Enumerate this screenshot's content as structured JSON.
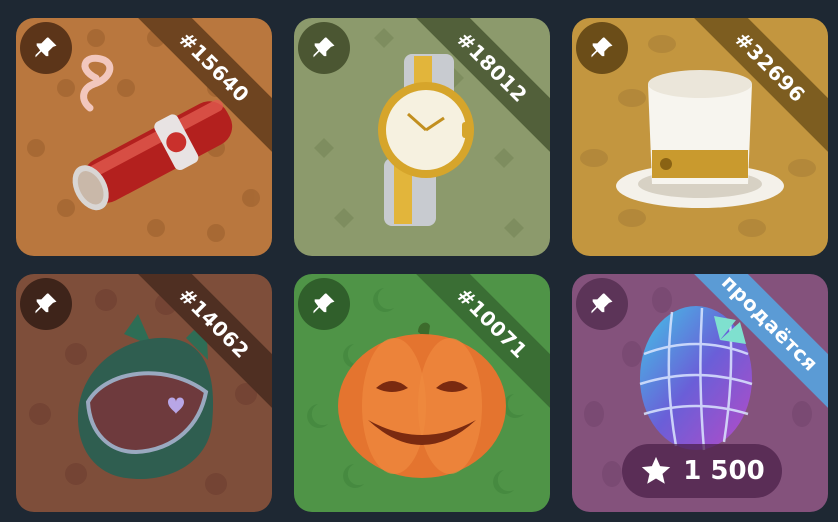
{
  "colors": {
    "page_bg": "#1e2833",
    "ribbon_sale": "#5b9bd5"
  },
  "cards": [
    {
      "id_label": "#15640",
      "item": "cigar",
      "pin_icon": "pin-icon",
      "bg": "#b9773e",
      "ribbon": "#6e4420",
      "pin_bg": "#5c3519",
      "pattern_color": "#a66834"
    },
    {
      "id_label": "#18012",
      "item": "gold-watch",
      "pin_icon": "pin-icon",
      "bg": "#8c9a6c",
      "ribbon": "#52603a",
      "pin_bg": "#4b5632",
      "pattern_color": "#7e8d5f"
    },
    {
      "id_label": "#32696",
      "item": "white-top-hat",
      "pin_icon": "pin-icon",
      "bg": "#c3963f",
      "ribbon": "#7d5d20",
      "pin_bg": "#6b4d18",
      "pattern_color": "#b3883a"
    },
    {
      "id_label": "#14062",
      "item": "cat-ear-helmet",
      "pin_icon": "pin-icon",
      "bg": "#7e4e3a",
      "ribbon": "#4f2f22",
      "pin_bg": "#3e241a",
      "pattern_color": "#744434"
    },
    {
      "id_label": "#10071",
      "item": "pumpkin",
      "pin_icon": "pin-icon",
      "bg": "#4f9447",
      "ribbon": "#3a6e34",
      "pin_bg": "#305f2b",
      "pattern_color": "#468a40"
    },
    {
      "id_label": "продаётся",
      "item": "easter-egg",
      "pin_icon": "pin-icon",
      "bg": "#84527c",
      "ribbon": "#5b9bd5",
      "pin_bg": "#5c3458",
      "pattern_color": "#7a4a73",
      "price": {
        "amount": "1 500",
        "currency_icon": "star-icon"
      }
    }
  ]
}
